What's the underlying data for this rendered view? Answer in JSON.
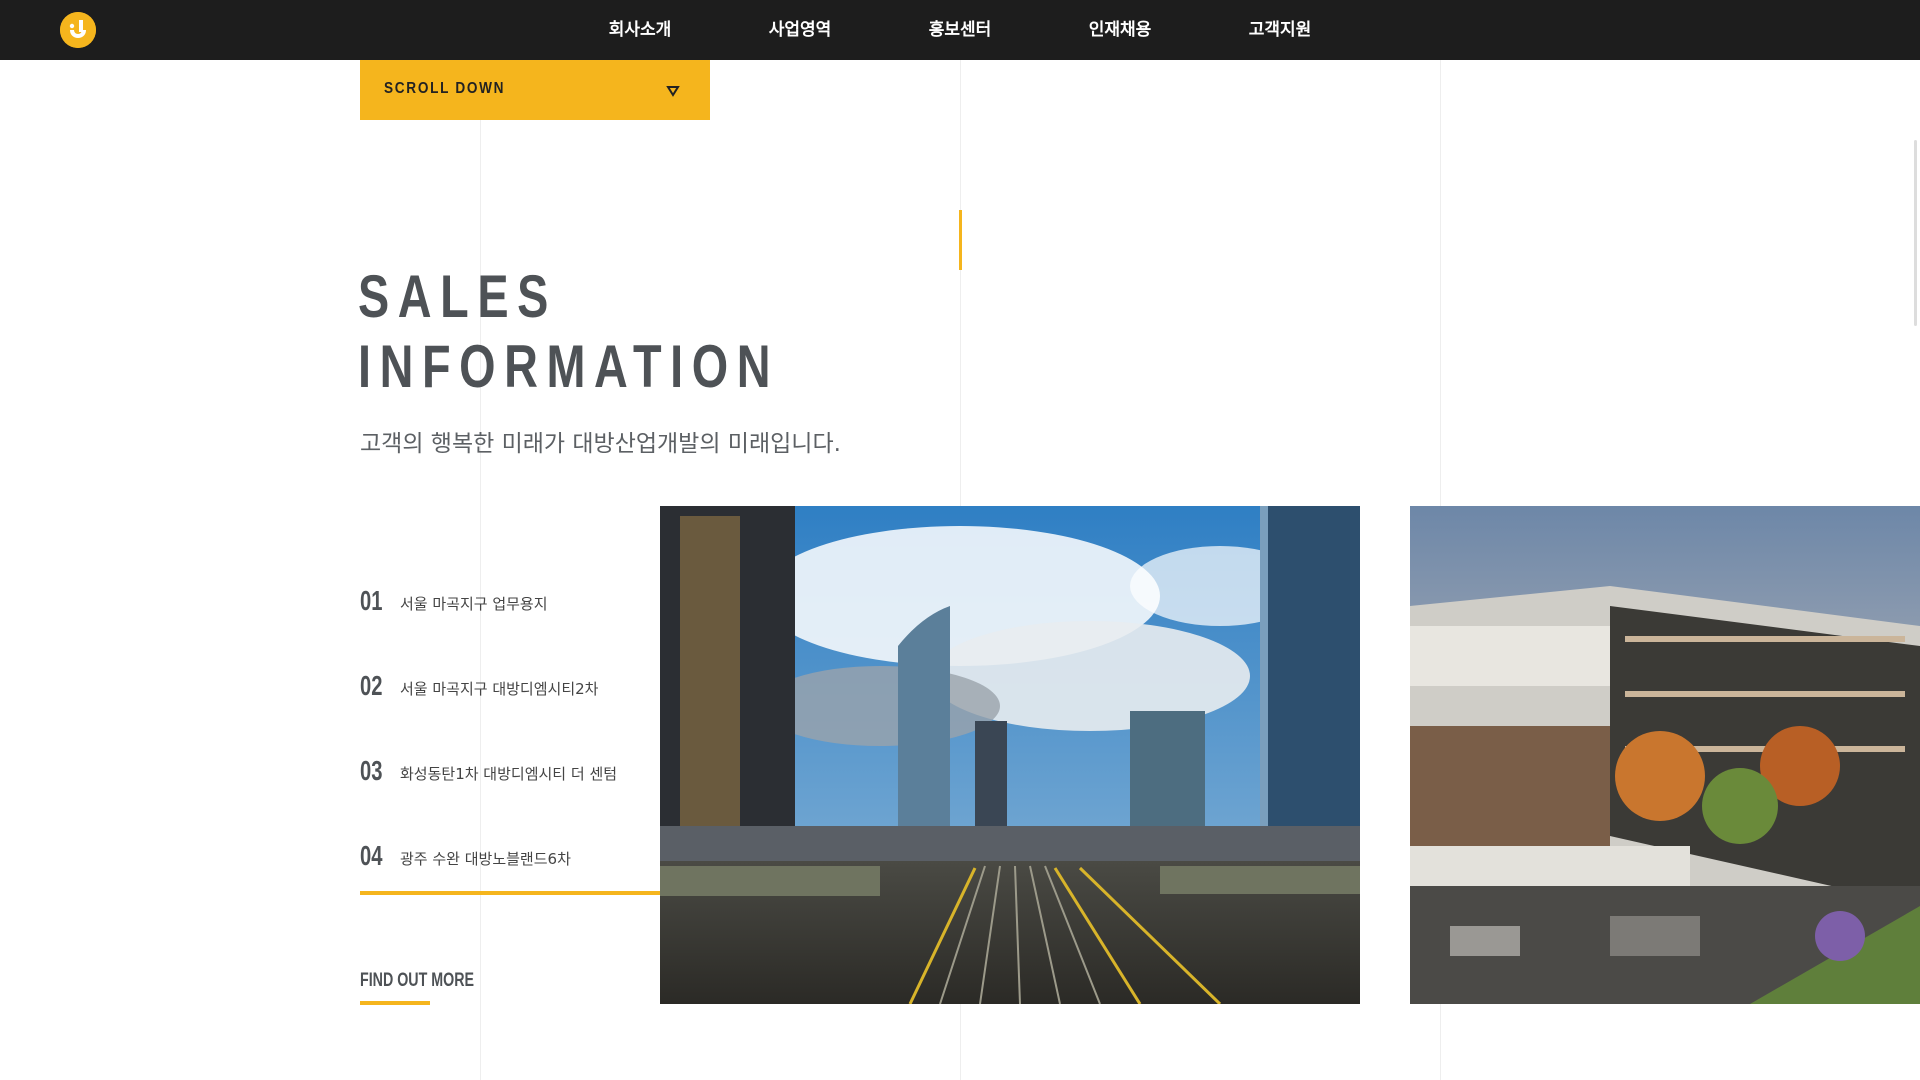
{
  "header": {
    "logo_icon": "company-logo-icon",
    "nav": [
      {
        "label": "회사소개"
      },
      {
        "label": "사업영역"
      },
      {
        "label": "홍보센터"
      },
      {
        "label": "인재채용"
      },
      {
        "label": "고객지원"
      }
    ]
  },
  "scroll": {
    "label": "SCROLL DOWN",
    "icon": "triangle-down-icon"
  },
  "section": {
    "title_line1": "SALES",
    "title_line2": "INFORMATION",
    "subtitle": "고객의 행복한 미래가 대방산업개발의 미래입니다."
  },
  "list": [
    {
      "num": "01",
      "text": "서울 마곡지구 업무용지"
    },
    {
      "num": "02",
      "text": "서울 마곡지구 대방디엠시티2차"
    },
    {
      "num": "03",
      "text": "화성동탄1차 대방디엠시티 더 센텀"
    },
    {
      "num": "04",
      "text": "광주 수완 대방노블랜드6차"
    }
  ],
  "cta": {
    "label": "FIND OUT MORE"
  },
  "colors": {
    "accent": "#f5b51d",
    "header_bg": "#1d1d1d",
    "text_dark": "#4e5256"
  }
}
